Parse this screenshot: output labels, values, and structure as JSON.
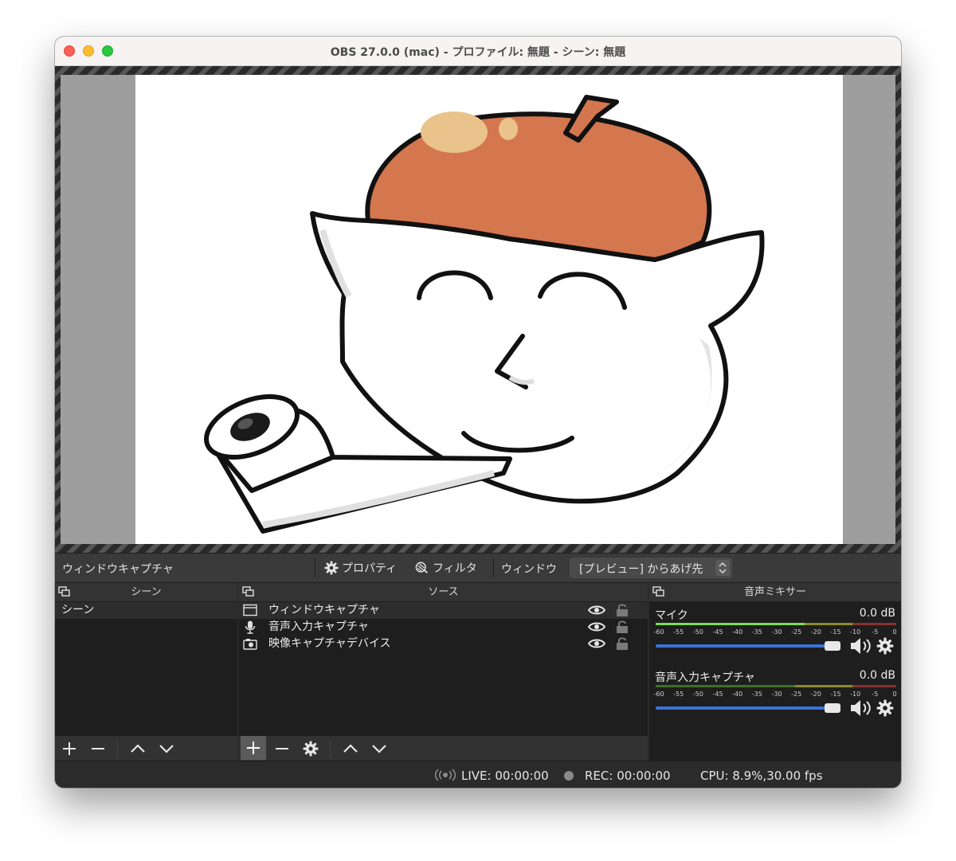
{
  "window": {
    "title": "OBS 27.0.0 (mac) - プロファイル: 無題 - シーン: 無題"
  },
  "context_bar": {
    "source_name": "ウィンドウキャプチャ",
    "properties_label": "プロパティ",
    "filters_label": "フィルタ",
    "window_label": "ウィンドウ",
    "window_select_value": "[プレビュー] からあげ先"
  },
  "scenes": {
    "title": "シーン",
    "items": [
      {
        "label": "シーン"
      }
    ]
  },
  "sources": {
    "title": "ソース",
    "items": [
      {
        "label": "ウィンドウキャプチャ",
        "icon": "window-icon"
      },
      {
        "label": "音声入力キャプチャ",
        "icon": "microphone-icon"
      },
      {
        "label": "映像キャプチャデバイス",
        "icon": "camera-icon"
      }
    ]
  },
  "mixer": {
    "title": "音声ミキサー",
    "ticks": [
      "-60",
      "-55",
      "-50",
      "-45",
      "-40",
      "-35",
      "-30",
      "-25",
      "-20",
      "-15",
      "-10",
      "-5",
      "0"
    ],
    "channels": [
      {
        "name": "マイク",
        "db": "0.0 dB",
        "volume": 1.0,
        "level": 0.62
      },
      {
        "name": "音声入力キャプチャ",
        "db": "0.0 dB",
        "volume": 1.0,
        "level": 0.0
      }
    ]
  },
  "status": {
    "live": "LIVE: 00:00:00",
    "rec": "REC: 00:00:00",
    "cpu": "CPU: 8.9%,30.00 fps"
  },
  "colors": {
    "accent_slider": "#3a73d6",
    "meter_green": "#7bdc58",
    "hat_orange": "#d4764e"
  }
}
